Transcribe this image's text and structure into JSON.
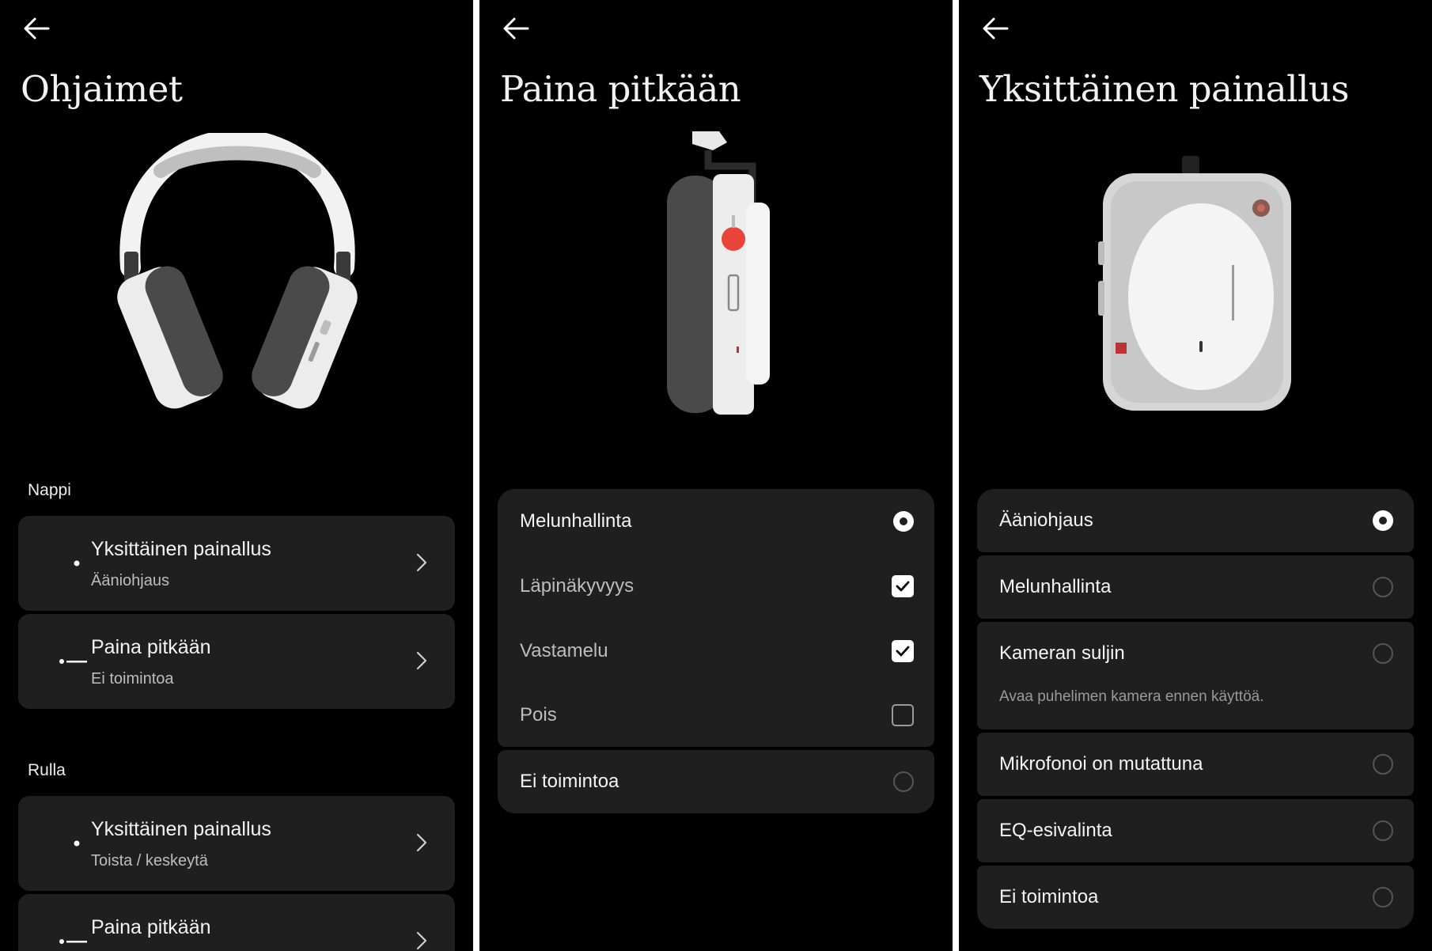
{
  "colors": {
    "background": "#000000",
    "card": "#1f1f1f",
    "text": "#ffffff",
    "subtext": "#bdbdbd",
    "accent_red": "#e8443a"
  },
  "screen1": {
    "title": "Ohjaimet",
    "icon": "back-arrow-icon",
    "section_button": "Nappi",
    "section_roller": "Rulla",
    "button_items": [
      {
        "title": "Yksittäinen painallus",
        "subtitle": "Ääniohjaus",
        "icon": "single-press-icon"
      },
      {
        "title": "Paina pitkään",
        "subtitle": "Ei toimintoa",
        "icon": "long-press-icon"
      }
    ],
    "roller_items": [
      {
        "title": "Yksittäinen painallus",
        "subtitle": "Toista / keskeytä",
        "icon": "single-press-icon"
      },
      {
        "title": "Paina pitkään",
        "subtitle": "",
        "icon": "long-press-icon"
      }
    ]
  },
  "screen2": {
    "title": "Paina pitkään",
    "icon": "back-arrow-icon",
    "options": [
      {
        "label": "Melunhallinta",
        "control": "radio",
        "selected": true
      },
      {
        "label": "Läpinäkyvyys",
        "control": "checkbox",
        "checked": true
      },
      {
        "label": "Vastamelu",
        "control": "checkbox",
        "checked": true
      },
      {
        "label": "Pois",
        "control": "checkbox",
        "checked": false
      },
      {
        "label": "Ei toimintoa",
        "control": "radio",
        "selected": false
      }
    ]
  },
  "screen3": {
    "title": "Yksittäinen painallus",
    "icon": "back-arrow-icon",
    "options": [
      {
        "label": "Ääniohjaus",
        "selected": true
      },
      {
        "label": "Melunhallinta",
        "selected": false
      },
      {
        "label": "Kameran suljin",
        "selected": false,
        "note": "Avaa puhelimen kamera ennen käyttöä."
      },
      {
        "label": "Mikrofonoi on mutattuna",
        "selected": false
      },
      {
        "label": "EQ-esivalinta",
        "selected": false
      },
      {
        "label": "Ei toimintoa",
        "selected": false
      }
    ]
  }
}
